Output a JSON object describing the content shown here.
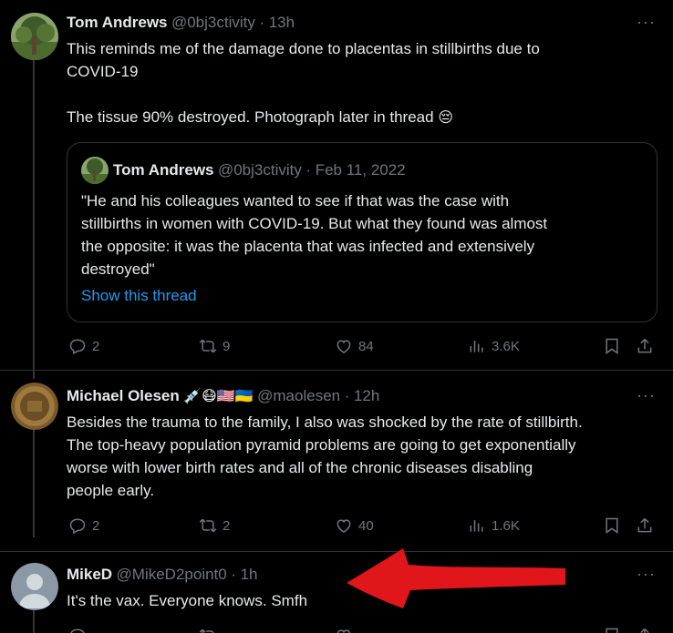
{
  "tweets": [
    {
      "name": "Tom Andrews",
      "handle": "@0bj3ctivity",
      "time": "· 13h",
      "text_1": "This reminds me of the damage done to placentas in stillbirths due to",
      "text_2": "COVID-19",
      "text_3": "The tissue 90% destroyed. Photograph later in thread",
      "emoji": "😔",
      "quote": {
        "name": "Tom Andrews",
        "handle": "@0bj3ctivity",
        "date": "· Feb 11, 2022",
        "lines": [
          "\"He and his colleagues wanted to see if that was the case with",
          "stillbirths in women with COVID-19. But what they found was almost",
          "the opposite: it was the placenta that was infected and extensively",
          "destroyed\""
        ],
        "show_thread": "Show this thread"
      },
      "replies": "2",
      "retweets": "9",
      "likes": "84",
      "views": "3.6K"
    },
    {
      "name": "Michael Olesen",
      "name_emojis": "💉😷🇺🇸🇺🇦",
      "handle": "@maolesen",
      "time": "· 12h",
      "lines": [
        "Besides the trauma to the family, I also was shocked by the rate of stillbirth.",
        "The top-heavy population pyramid problems are going to get exponentially",
        "worse with lower birth rates and all of the chronic diseases disabling",
        "people early."
      ],
      "replies": "2",
      "retweets": "2",
      "likes": "40",
      "views": "1.6K"
    },
    {
      "name": "MikeD",
      "handle": "@MikeD2point0",
      "time": "· 1h",
      "text": "It's the vax. Everyone knows. Smfh"
    }
  ],
  "more_glyph": "···",
  "colors": {
    "background": "#000000",
    "text": "#e7e9ea",
    "muted": "#71767b",
    "link": "#1d9bf0",
    "border": "#2f3336",
    "arrow": "#e0161b"
  },
  "icons": [
    "reply-icon",
    "retweet-icon",
    "like-icon",
    "views-icon",
    "bookmark-icon",
    "share-icon",
    "more-icon",
    "red-arrow-annotation"
  ]
}
